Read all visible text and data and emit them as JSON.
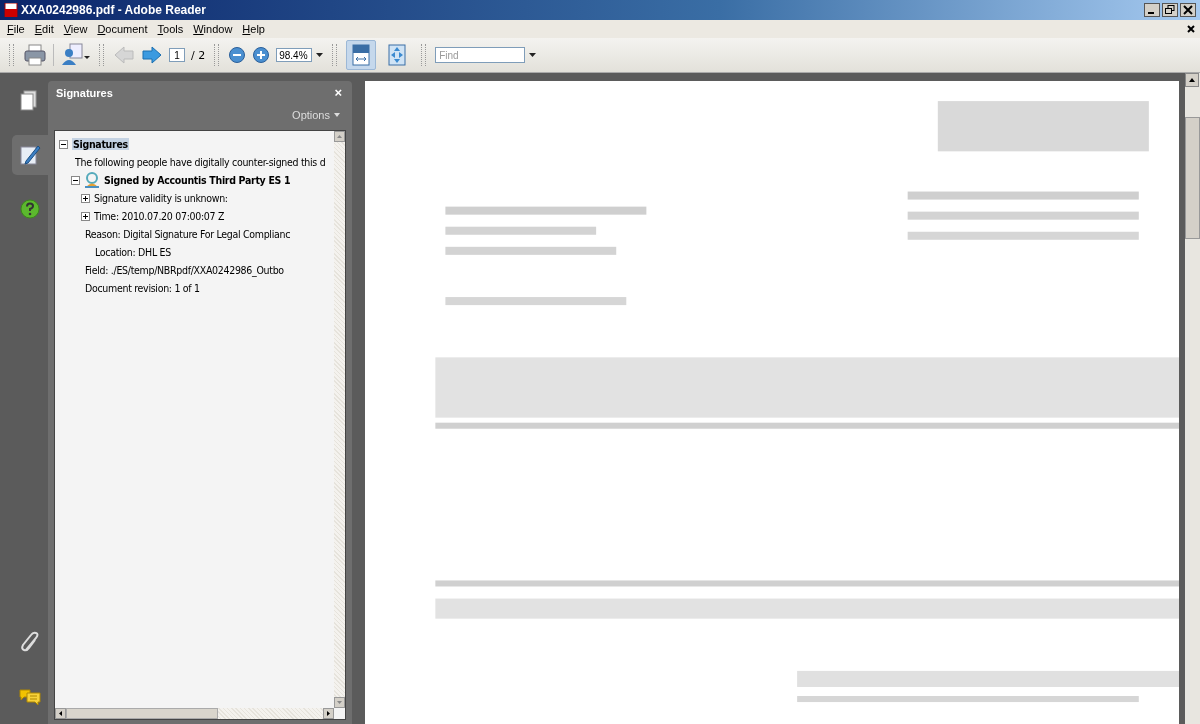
{
  "window": {
    "title": "XXA0242986.pdf - Adobe Reader"
  },
  "menu": [
    "File",
    "Edit",
    "View",
    "Document",
    "Tools",
    "Window",
    "Help"
  ],
  "toolbar": {
    "prev_page": {
      "disabled": true
    },
    "next_page": {
      "disabled": false
    },
    "page_field": {
      "value": "1"
    },
    "page_total": "/ 2",
    "zoom_field": {
      "value": "98.4%"
    },
    "fit_width": {
      "selected": true
    },
    "full_screen": {
      "selected": false
    },
    "find_field": {
      "placeholder": "Find"
    }
  },
  "nav_tabs": [
    {
      "kind": "pages",
      "selected": false
    },
    {
      "kind": "signatures",
      "selected": true
    },
    {
      "kind": "help",
      "selected": false
    },
    {
      "kind": "attachments",
      "selected": false
    },
    {
      "kind": "comments",
      "selected": false
    }
  ],
  "panel": {
    "title": "Signatures",
    "close": "×",
    "options": "Options",
    "tree": [
      {
        "label": "Signatures",
        "kind": "group",
        "expanded": true,
        "selected": true,
        "children": [
          {
            "label": "The following people have digitally counter-signed this d"
          },
          {
            "label": "Signed by Accountis Third Party ES 1",
            "kind": "signer",
            "expanded": true,
            "children": [
              {
                "label": "Signature validity is unknown:",
                "expanded": false
              },
              {
                "label": "Time: 2010.07.20 07:00:07 Z",
                "expanded": false
              },
              {
                "label": "Reason: Digital Signature For Legal Complianc",
                "children": [
                  {
                    "label": "Location: DHL ES"
                  }
                ]
              },
              {
                "label": "Field: ./ES/temp/NBRpdf/XXA0242986_Outbo"
              },
              {
                "label": "Document revision: 1 of 1"
              }
            ]
          }
        ]
      }
    ]
  }
}
